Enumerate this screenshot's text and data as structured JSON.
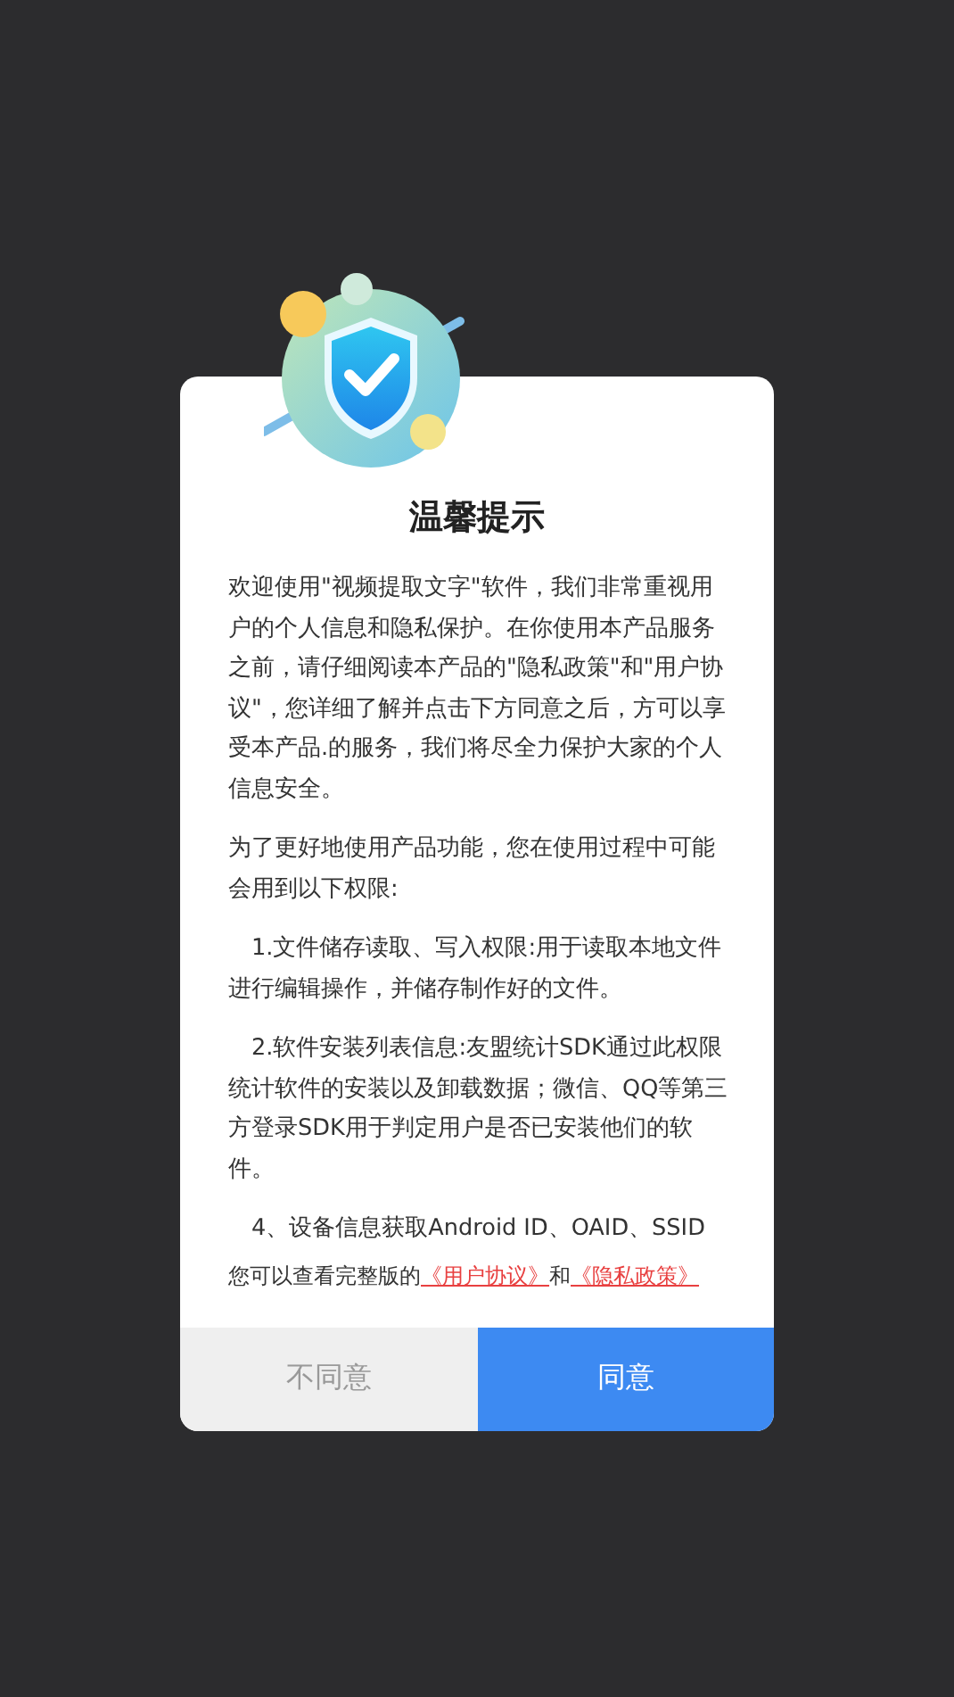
{
  "dialog": {
    "title": "温馨提示",
    "paragraphs": [
      {
        "kind": "plain",
        "text": "欢迎使用\"视频提取文字\"软件，我们非常重视用户的个人信息和隐私保护。在你使用本产品服务之前，请仔细阅读本产品的\"隐私政策\"和\"用户协议\"，您详细了解并点击下方同意之后，方可以享受本产品.的服务，我们将尽全力保护大家的个人信息安全。"
      },
      {
        "kind": "plain",
        "text": "为了更好地使用产品功能，您在使用过程中可能会用到以下权限:"
      },
      {
        "kind": "indented",
        "text": "1.文件储存读取、写入权限:用于读取本地文件进行编辑操作，并储存制作好的文件。"
      },
      {
        "kind": "indented",
        "text": "2.软件安装列表信息:友盟统计SDK通过此权限统计软件的安装以及卸载数据；微信、QQ等第三方登录SDK用于判定用户是否已安装他们的软件。"
      },
      {
        "kind": "indented",
        "text": "4、设备信息获取Android ID、OAID、SSID"
      }
    ],
    "footer": {
      "text": "您可以查看完整版的",
      "link1": "《用户协议》",
      "joiner": "和",
      "link2": "《隐私政策》"
    },
    "buttons": [
      {
        "label": "不同意",
        "kind": "secondary"
      },
      {
        "label": "同意",
        "kind": "primary"
      }
    ]
  }
}
